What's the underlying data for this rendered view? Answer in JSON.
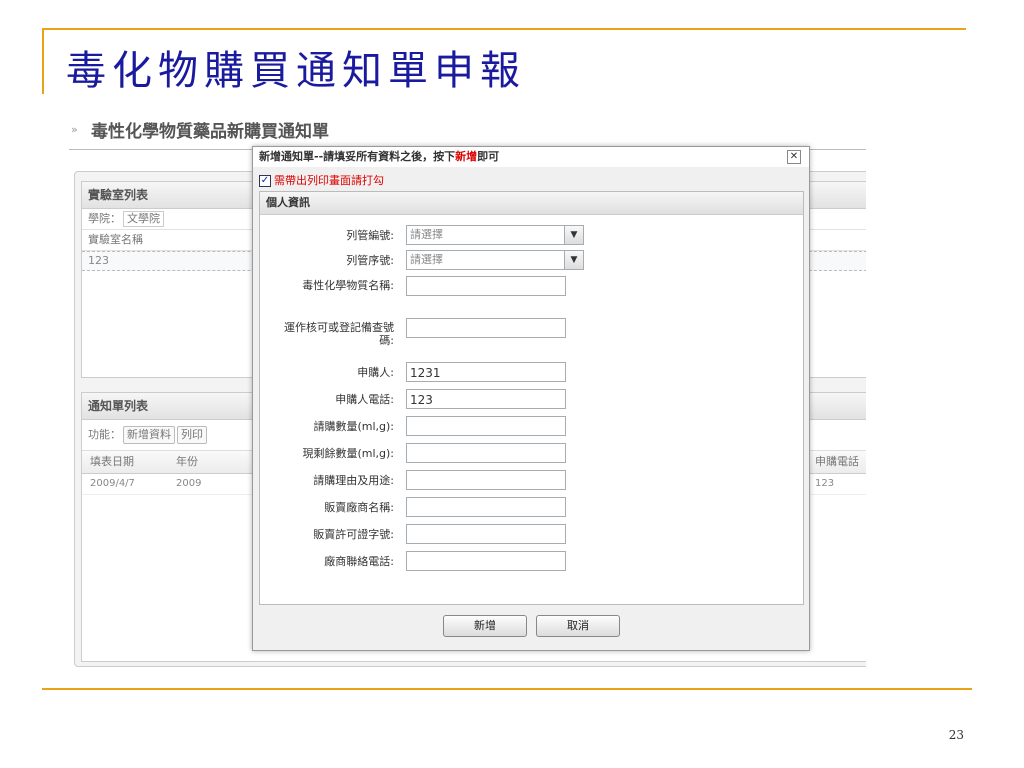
{
  "slide": {
    "title": "毒化物購買通知單申報",
    "page_number": "23"
  },
  "app": {
    "title": "毒性化學物質藥品新購買通知單",
    "lab_panel": {
      "title": "實驗室列表",
      "college_label": "學院：",
      "college_value": "文學院",
      "col_name": "實驗室名稱",
      "row_value": "123"
    },
    "notice_panel": {
      "title": "通知單列表",
      "func_label": "功能：",
      "add_btn": "新增資料",
      "print_btn": "列印",
      "headers": {
        "fill_date": "填表日期",
        "year": "年份",
        "phone": "申購電話"
      },
      "row": {
        "fill_date": "2009/4/7",
        "year": "2009",
        "phone": "123"
      }
    }
  },
  "dialog": {
    "title_prefix": "新增通知單--請填妥所有資料之後，按下",
    "title_highlight": "新增",
    "title_suffix": "即可",
    "close_glyph": "✕",
    "print_check_label": "需帶出列印畫面請打勾",
    "print_checked_glyph": "✓",
    "section_title": "個人資訊",
    "fields": {
      "list_no": {
        "label": "列管編號:",
        "placeholder": "請選擇"
      },
      "list_seq": {
        "label": "列管序號:",
        "placeholder": "請選擇"
      },
      "chem_name": {
        "label": "毒性化學物質名稱:",
        "value": ""
      },
      "permit_no": {
        "label": "運作核可或登記備查號碼:",
        "value": ""
      },
      "applicant": {
        "label": "申購人:",
        "value": "1231"
      },
      "applicant_phone": {
        "label": "申購人電話:",
        "value": "123"
      },
      "request_qty": {
        "label": "請購數量(ml,g):",
        "value": ""
      },
      "remaining_qty": {
        "label": "現剩餘數量(ml,g):",
        "value": ""
      },
      "reason": {
        "label": "請購理由及用途:",
        "value": ""
      },
      "vendor_name": {
        "label": "販賣廠商名稱:",
        "value": ""
      },
      "vendor_license": {
        "label": "販賣許可證字號:",
        "value": ""
      },
      "vendor_phone": {
        "label": "廠商聯絡電話:",
        "value": ""
      }
    },
    "add_button": "新增",
    "cancel_button": "取消",
    "dropdown_glyph": "▼"
  },
  "colors": {
    "accent_line": "#e8a317",
    "title_blue": "#1a1a9e",
    "highlight_red": "#dd0000"
  }
}
